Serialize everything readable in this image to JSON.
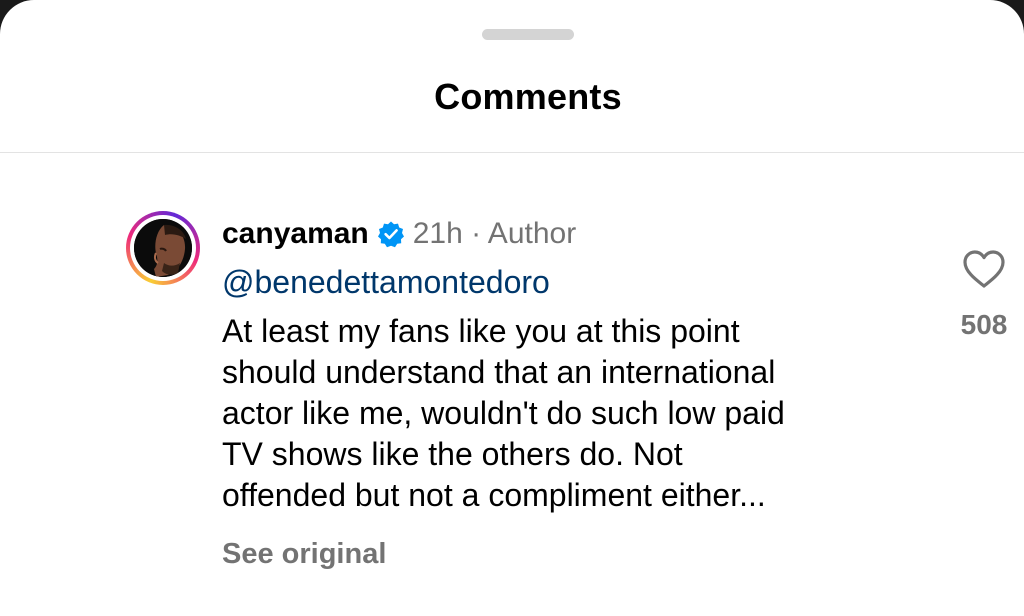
{
  "sheet": {
    "title": "Comments"
  },
  "comment": {
    "username": "canyaman",
    "verified_icon": "verified-badge-icon",
    "meta": "21h · Author",
    "mention": "@benedettamontedoro",
    "lines": [
      "At least my fans like you at this point",
      "should understand that an international",
      "actor like me, wouldn't do such low paid",
      "TV shows like the others do. Not",
      "offended but not a compliment either..."
    ],
    "see_original": "See original",
    "like_icon": "heart-icon",
    "like_count": "508"
  },
  "colors": {
    "verified": "#0095f6",
    "mention": "#00376b",
    "secondary_text": "#737373",
    "divider": "#e3e3e3"
  }
}
